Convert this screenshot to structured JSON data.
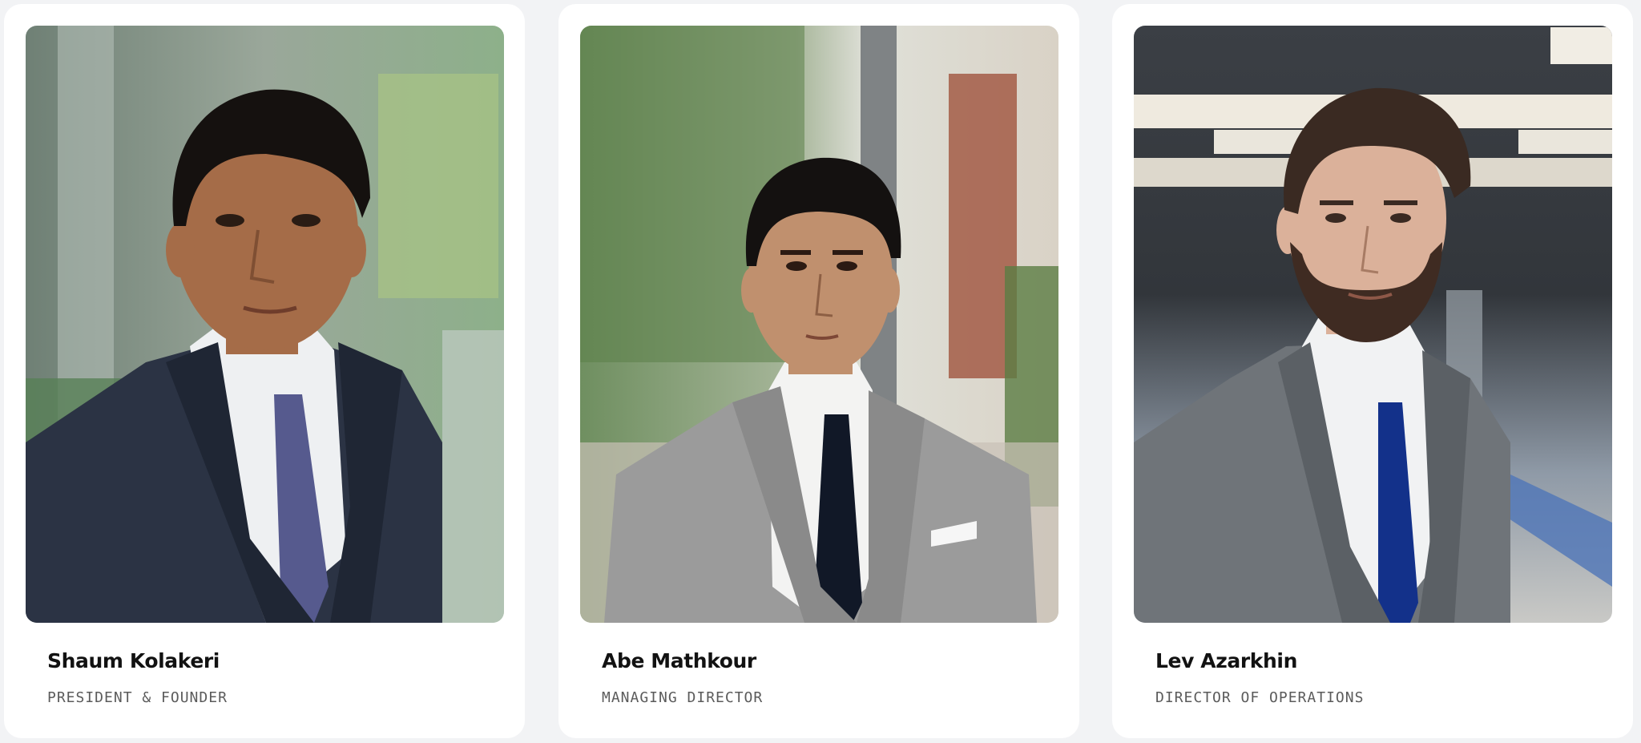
{
  "team": {
    "members": [
      {
        "name": "Shaum Kolakeri",
        "role": "PRESIDENT & FOUNDER",
        "photo": {
          "background": "#7d9684",
          "suit": "#2b3344",
          "shirt": "#eef0f2",
          "tie": "#565a8e",
          "skin": "#a56c48",
          "hair": "#15110f"
        }
      },
      {
        "name": "Abe Mathkour",
        "role": "MANAGING DIRECTOR",
        "photo": {
          "background": "#b8bca8",
          "suit": "#9b9b9b",
          "shirt": "#f3f3f2",
          "tie": "#111827",
          "skin": "#c0906e",
          "hair": "#141110"
        }
      },
      {
        "name": "Lev Azarkhin",
        "role": "DIRECTOR OF OPERATIONS",
        "photo": {
          "background": "#4e5560",
          "suit": "#6f7479",
          "shirt": "#f1f2f3",
          "tie": "#13318a",
          "skin": "#dbb19a",
          "hair": "#3a2a22"
        }
      }
    ]
  }
}
